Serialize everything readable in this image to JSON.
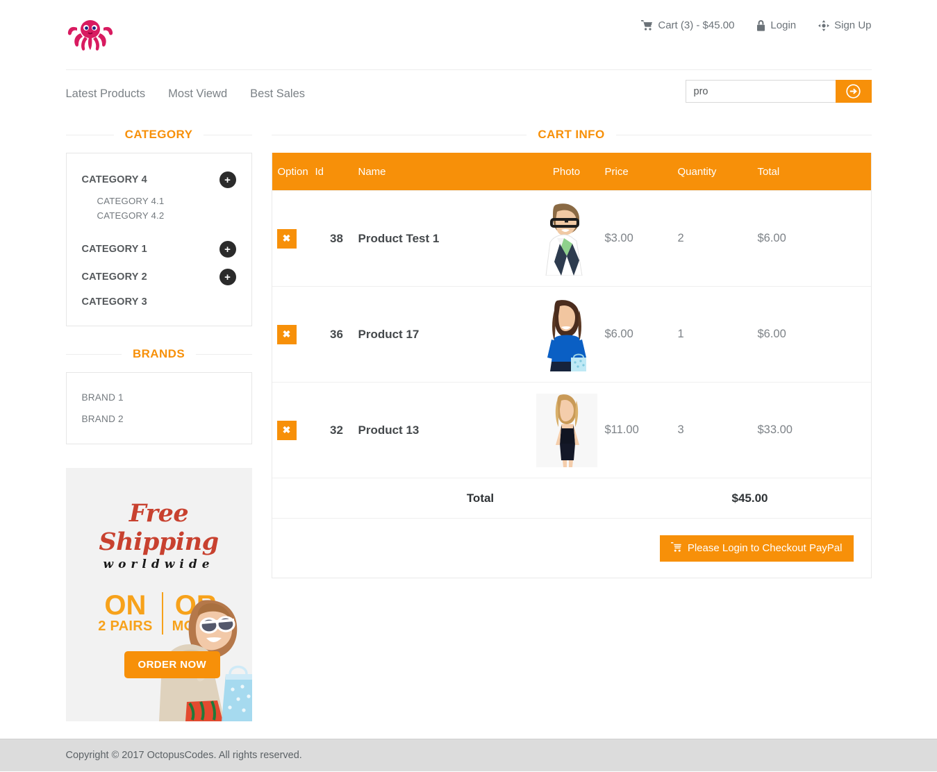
{
  "header": {
    "logo_alt": "octopus-logo",
    "links": [
      {
        "icon": "cart-icon",
        "label": "Cart (3) - $45.00"
      },
      {
        "icon": "lock-icon",
        "label": "Login"
      },
      {
        "icon": "signup-icon",
        "label": "Sign Up"
      }
    ]
  },
  "nav": {
    "items": [
      "Latest Products",
      "Most Viewd",
      "Best Sales"
    ],
    "search": {
      "value": "pro",
      "placeholder": "",
      "button_icon": "arrow-circle-right-icon"
    }
  },
  "sidebar": {
    "category_heading": "CATEGORY",
    "categories": [
      {
        "label": "CATEGORY 4",
        "expandable": true,
        "subcategories": [
          "CATEGORY 4.1",
          "CATEGORY 4.2"
        ]
      },
      {
        "label": "CATEGORY 1",
        "expandable": true,
        "subcategories": []
      },
      {
        "label": "CATEGORY 2",
        "expandable": true,
        "subcategories": []
      },
      {
        "label": "CATEGORY 3",
        "expandable": false,
        "subcategories": []
      }
    ],
    "brands_heading": "BRANDS",
    "brands": [
      "BRAND 1",
      "BRAND 2"
    ],
    "banner": {
      "title": "Free Shipping",
      "subtitle": "worldwide",
      "col1_big": "ON",
      "col1_small": "2 PAIRS",
      "col2_big": "OR",
      "col2_small": "MORE!",
      "cta": "ORDER NOW"
    }
  },
  "cart": {
    "heading": "CART INFO",
    "columns": [
      "Option",
      "Id",
      "Name",
      "Photo",
      "Price",
      "Quantity",
      "Total"
    ],
    "rows": [
      {
        "remove": "✖",
        "id": "38",
        "name": "Product Test 1",
        "photo": "man-glasses-polo-photo",
        "price": "$3.00",
        "quantity": "2",
        "total": "$6.00"
      },
      {
        "remove": "✖",
        "id": "36",
        "name": "Product 17",
        "photo": "woman-blue-top-photo",
        "price": "$6.00",
        "quantity": "1",
        "total": "$6.00"
      },
      {
        "remove": "✖",
        "id": "32",
        "name": "Product 13",
        "photo": "woman-black-dress-photo",
        "price": "$11.00",
        "quantity": "3",
        "total": "$33.00"
      }
    ],
    "total_label": "Total",
    "total_value": "$45.00",
    "checkout_label": "Please Login to Checkout PayPal"
  },
  "footer": {
    "copyright": "Copyright © 2017 OctopusCodes. All rights reserved."
  },
  "colors": {
    "accent": "#f79009",
    "banner_red": "#c8412f",
    "banner_orange": "#f7a21b",
    "footer_bg": "#dcdcdc",
    "logo_pink": "#e0246e"
  }
}
